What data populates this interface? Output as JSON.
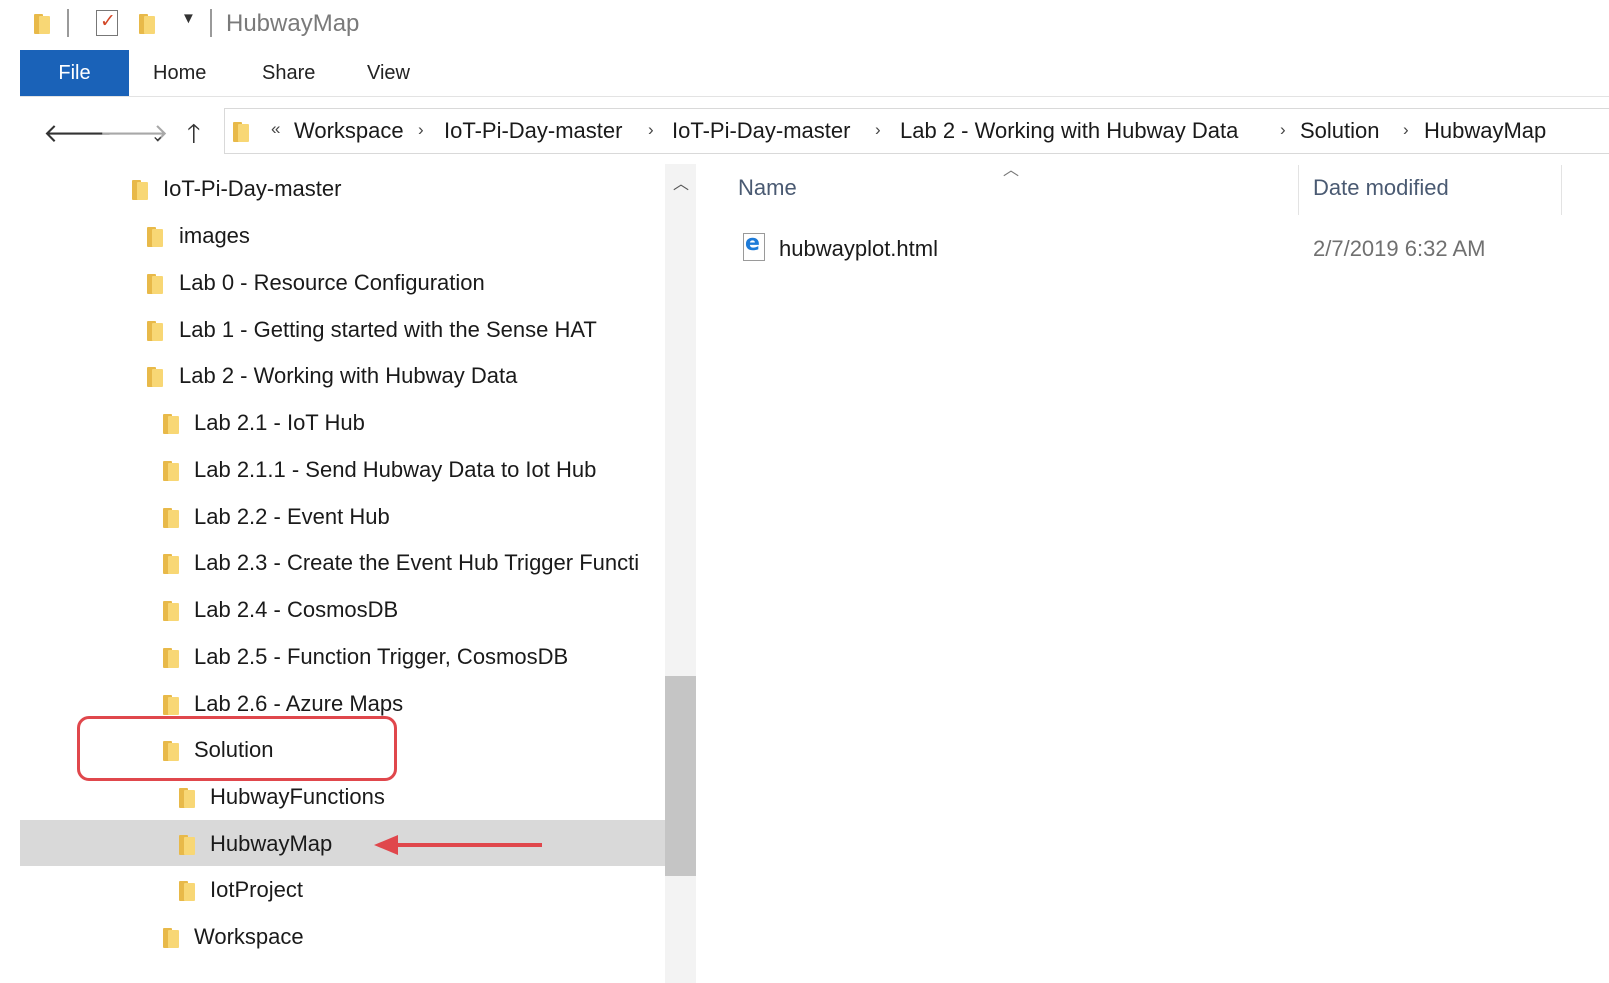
{
  "window": {
    "title": "HubwayMap"
  },
  "quick_access": {
    "icons": [
      "folder-icon",
      "properties-icon",
      "new-folder-icon",
      "customize-dropdown-icon"
    ]
  },
  "ribbon": {
    "tabs": [
      {
        "label": "File",
        "active": true
      },
      {
        "label": "Home"
      },
      {
        "label": "Share"
      },
      {
        "label": "View"
      }
    ]
  },
  "navigation": {
    "back": "back-arrow-icon",
    "forward": "forward-arrow-icon",
    "recent": "recent-locations-icon",
    "up": "up-arrow-icon"
  },
  "address_bar": {
    "overflow": "«",
    "separator": "›",
    "crumbs": [
      "Workspace",
      "IoT-Pi-Day-master",
      "IoT-Pi-Day-master",
      "Lab 2 - Working with Hubway Data",
      "Solution",
      "HubwayMap"
    ]
  },
  "tree": {
    "items": [
      {
        "label": "IoT-Pi-Day-master",
        "level": 0
      },
      {
        "label": "images",
        "level": 1
      },
      {
        "label": "Lab 0 - Resource Configuration",
        "level": 1
      },
      {
        "label": "Lab 1 - Getting started with the Sense HAT",
        "level": 1
      },
      {
        "label": "Lab 2 - Working with Hubway Data",
        "level": 1
      },
      {
        "label": "Lab 2.1 - IoT Hub",
        "level": 2
      },
      {
        "label": "Lab 2.1.1 - Send Hubway Data to Iot Hub",
        "level": 2
      },
      {
        "label": "Lab 2.2 - Event Hub",
        "level": 2
      },
      {
        "label": "Lab 2.3 - Create the Event Hub Trigger Functi",
        "level": 2
      },
      {
        "label": "Lab 2.4 - CosmosDB",
        "level": 2
      },
      {
        "label": "Lab 2.5 - Function Trigger, CosmosDB",
        "level": 2
      },
      {
        "label": "Lab 2.6 - Azure Maps",
        "level": 2
      },
      {
        "label": "Solution",
        "level": 2,
        "highlighted": true
      },
      {
        "label": "HubwayFunctions",
        "level": 3
      },
      {
        "label": "HubwayMap",
        "level": 3,
        "selected": true
      },
      {
        "label": "IotProject",
        "level": 3
      },
      {
        "label": "Workspace",
        "level": 2
      }
    ]
  },
  "content": {
    "columns": [
      "Name",
      "Date modified"
    ],
    "files": [
      {
        "name": "hubwayplot.html",
        "date_modified": "2/7/2019 6:32 AM",
        "icon": "edge-html-file-icon"
      }
    ]
  },
  "colors": {
    "file_tab": "#1a62b8",
    "selection": "#d9d9d9",
    "annotation": "#e0474c",
    "folder": "#f8d775"
  }
}
